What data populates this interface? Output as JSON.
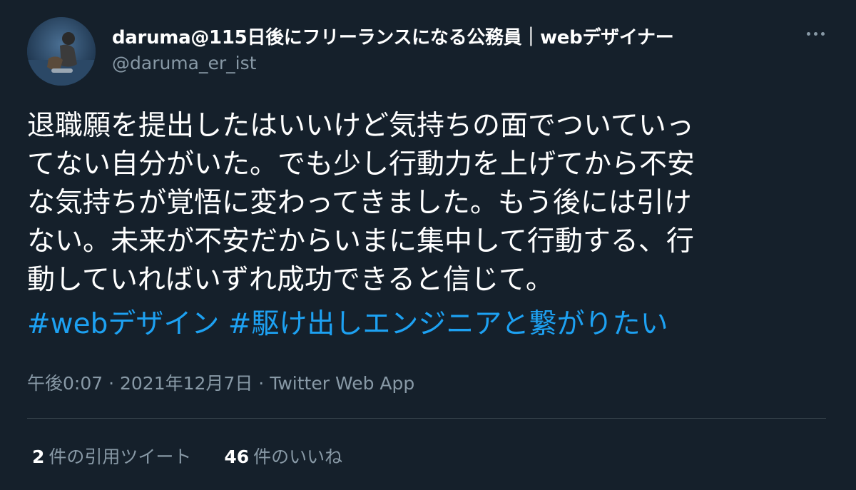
{
  "author": {
    "display_name": "daruma@115日後にフリーランスになる公務員｜webデザイナー",
    "handle": "@daruma_er_ist",
    "avatar_icon": "avatar-photo"
  },
  "more_icon": "more-horizontal-icon",
  "tweet": {
    "lines": [
      "退職願を提出したはいいけど気持ちの面でついていっ",
      "てない自分がいた。でも少し行動力を上げてから不安",
      "な気持ちが覚悟に変わってきました。もう後には引け",
      "ない。未来が不安だからいまに集中して行動する、行",
      "動していればいずれ成功できると信じて。"
    ],
    "hashtags": [
      "#webデザイン",
      "#駆け出しエンジニアと繋がりたい"
    ]
  },
  "meta": {
    "time": "午後0:07",
    "separator": "·",
    "date": "2021年12月7日",
    "source": "Twitter Web App"
  },
  "stats": {
    "quotes_count": "2",
    "quotes_label": "件の引用ツイート",
    "likes_count": "46",
    "likes_label": "件のいいね"
  },
  "colors": {
    "background": "#15202b",
    "text": "#ffffff",
    "secondary": "#8899a6",
    "link": "#1da1f2",
    "divider": "#38444d"
  }
}
